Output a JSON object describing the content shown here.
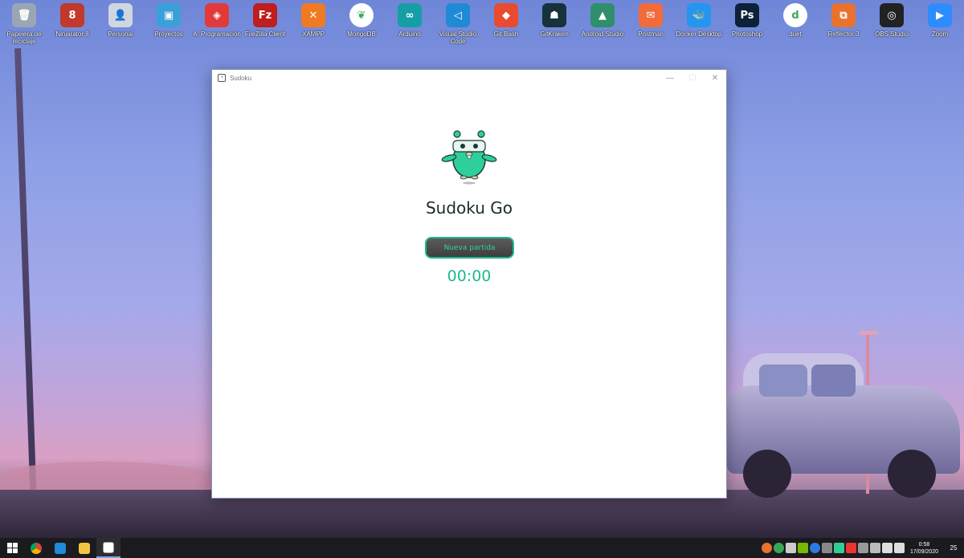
{
  "desktop_icons": [
    {
      "label": "Papelera de reciclaje",
      "color": "#9aa6b4",
      "glyph": "🗑"
    },
    {
      "label": "Ninjarator 8",
      "color": "#c0392b",
      "glyph": "8"
    },
    {
      "label": "Personal",
      "color": "#d0d6e0",
      "glyph": "👤"
    },
    {
      "label": "Proyectos",
      "color": "#3aa0d8",
      "glyph": "▣"
    },
    {
      "label": "A. Programacion",
      "color": "#e23a3a",
      "glyph": "◈"
    },
    {
      "label": "FileZilla Client",
      "color": "#bf1e1e",
      "glyph": "Fz"
    },
    {
      "label": "XAMPP",
      "color": "#f07a22",
      "glyph": "✕"
    },
    {
      "label": "MongoDB",
      "color": "#ffffff",
      "glyph": "❦"
    },
    {
      "label": "Arduino",
      "color": "#169ea6",
      "glyph": "∞"
    },
    {
      "label": "Visual Studio Code",
      "color": "#1f8ad6",
      "glyph": "◁"
    },
    {
      "label": "Git Bash",
      "color": "#e84b2f",
      "glyph": "◆"
    },
    {
      "label": "GitKraken",
      "color": "#17323a",
      "glyph": "☗"
    },
    {
      "label": "Android Studio",
      "color": "#2f8f6a",
      "glyph": "▲"
    },
    {
      "label": "Postman",
      "color": "#f26b3a",
      "glyph": "✉"
    },
    {
      "label": "Docker Desktop",
      "color": "#2496ed",
      "glyph": "🐳"
    },
    {
      "label": "Photoshop",
      "color": "#0d2238",
      "glyph": "Ps"
    },
    {
      "label": "duet",
      "color": "#ffffff",
      "glyph": "d"
    },
    {
      "label": "Reflector 3",
      "color": "#e8722e",
      "glyph": "⧉"
    },
    {
      "label": "OBS Studio",
      "color": "#222222",
      "glyph": "◎"
    },
    {
      "label": "Zoom",
      "color": "#2d8cff",
      "glyph": "▶"
    }
  ],
  "window": {
    "title": "Sudoku",
    "minimize": "—",
    "maximize": "☐",
    "close": "✕"
  },
  "app": {
    "title": "Sudoku Go",
    "new_game_label": "Nueva partida",
    "timer": "00:00"
  },
  "taskbar": {
    "clock_time": "0:58",
    "clock_date": "17/09/2020",
    "notification_count": "25"
  }
}
